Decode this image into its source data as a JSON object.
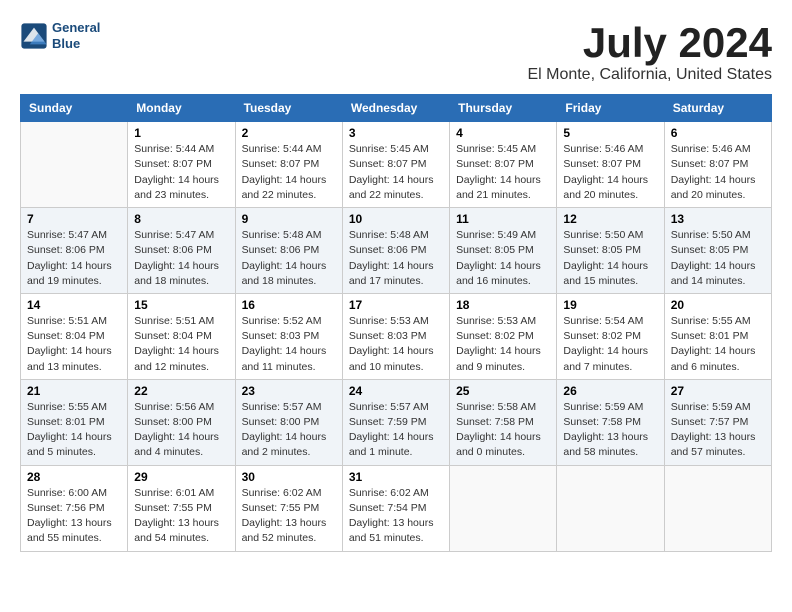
{
  "logo": {
    "line1": "General",
    "line2": "Blue"
  },
  "title": "July 2024",
  "location": "El Monte, California, United States",
  "weekdays": [
    "Sunday",
    "Monday",
    "Tuesday",
    "Wednesday",
    "Thursday",
    "Friday",
    "Saturday"
  ],
  "weeks": [
    [
      {
        "day": "",
        "info": ""
      },
      {
        "day": "1",
        "info": "Sunrise: 5:44 AM\nSunset: 8:07 PM\nDaylight: 14 hours\nand 23 minutes."
      },
      {
        "day": "2",
        "info": "Sunrise: 5:44 AM\nSunset: 8:07 PM\nDaylight: 14 hours\nand 22 minutes."
      },
      {
        "day": "3",
        "info": "Sunrise: 5:45 AM\nSunset: 8:07 PM\nDaylight: 14 hours\nand 22 minutes."
      },
      {
        "day": "4",
        "info": "Sunrise: 5:45 AM\nSunset: 8:07 PM\nDaylight: 14 hours\nand 21 minutes."
      },
      {
        "day": "5",
        "info": "Sunrise: 5:46 AM\nSunset: 8:07 PM\nDaylight: 14 hours\nand 20 minutes."
      },
      {
        "day": "6",
        "info": "Sunrise: 5:46 AM\nSunset: 8:07 PM\nDaylight: 14 hours\nand 20 minutes."
      }
    ],
    [
      {
        "day": "7",
        "info": "Sunrise: 5:47 AM\nSunset: 8:06 PM\nDaylight: 14 hours\nand 19 minutes."
      },
      {
        "day": "8",
        "info": "Sunrise: 5:47 AM\nSunset: 8:06 PM\nDaylight: 14 hours\nand 18 minutes."
      },
      {
        "day": "9",
        "info": "Sunrise: 5:48 AM\nSunset: 8:06 PM\nDaylight: 14 hours\nand 18 minutes."
      },
      {
        "day": "10",
        "info": "Sunrise: 5:48 AM\nSunset: 8:06 PM\nDaylight: 14 hours\nand 17 minutes."
      },
      {
        "day": "11",
        "info": "Sunrise: 5:49 AM\nSunset: 8:05 PM\nDaylight: 14 hours\nand 16 minutes."
      },
      {
        "day": "12",
        "info": "Sunrise: 5:50 AM\nSunset: 8:05 PM\nDaylight: 14 hours\nand 15 minutes."
      },
      {
        "day": "13",
        "info": "Sunrise: 5:50 AM\nSunset: 8:05 PM\nDaylight: 14 hours\nand 14 minutes."
      }
    ],
    [
      {
        "day": "14",
        "info": "Sunrise: 5:51 AM\nSunset: 8:04 PM\nDaylight: 14 hours\nand 13 minutes."
      },
      {
        "day": "15",
        "info": "Sunrise: 5:51 AM\nSunset: 8:04 PM\nDaylight: 14 hours\nand 12 minutes."
      },
      {
        "day": "16",
        "info": "Sunrise: 5:52 AM\nSunset: 8:03 PM\nDaylight: 14 hours\nand 11 minutes."
      },
      {
        "day": "17",
        "info": "Sunrise: 5:53 AM\nSunset: 8:03 PM\nDaylight: 14 hours\nand 10 minutes."
      },
      {
        "day": "18",
        "info": "Sunrise: 5:53 AM\nSunset: 8:02 PM\nDaylight: 14 hours\nand 9 minutes."
      },
      {
        "day": "19",
        "info": "Sunrise: 5:54 AM\nSunset: 8:02 PM\nDaylight: 14 hours\nand 7 minutes."
      },
      {
        "day": "20",
        "info": "Sunrise: 5:55 AM\nSunset: 8:01 PM\nDaylight: 14 hours\nand 6 minutes."
      }
    ],
    [
      {
        "day": "21",
        "info": "Sunrise: 5:55 AM\nSunset: 8:01 PM\nDaylight: 14 hours\nand 5 minutes."
      },
      {
        "day": "22",
        "info": "Sunrise: 5:56 AM\nSunset: 8:00 PM\nDaylight: 14 hours\nand 4 minutes."
      },
      {
        "day": "23",
        "info": "Sunrise: 5:57 AM\nSunset: 8:00 PM\nDaylight: 14 hours\nand 2 minutes."
      },
      {
        "day": "24",
        "info": "Sunrise: 5:57 AM\nSunset: 7:59 PM\nDaylight: 14 hours\nand 1 minute."
      },
      {
        "day": "25",
        "info": "Sunrise: 5:58 AM\nSunset: 7:58 PM\nDaylight: 14 hours\nand 0 minutes."
      },
      {
        "day": "26",
        "info": "Sunrise: 5:59 AM\nSunset: 7:58 PM\nDaylight: 13 hours\nand 58 minutes."
      },
      {
        "day": "27",
        "info": "Sunrise: 5:59 AM\nSunset: 7:57 PM\nDaylight: 13 hours\nand 57 minutes."
      }
    ],
    [
      {
        "day": "28",
        "info": "Sunrise: 6:00 AM\nSunset: 7:56 PM\nDaylight: 13 hours\nand 55 minutes."
      },
      {
        "day": "29",
        "info": "Sunrise: 6:01 AM\nSunset: 7:55 PM\nDaylight: 13 hours\nand 54 minutes."
      },
      {
        "day": "30",
        "info": "Sunrise: 6:02 AM\nSunset: 7:55 PM\nDaylight: 13 hours\nand 52 minutes."
      },
      {
        "day": "31",
        "info": "Sunrise: 6:02 AM\nSunset: 7:54 PM\nDaylight: 13 hours\nand 51 minutes."
      },
      {
        "day": "",
        "info": ""
      },
      {
        "day": "",
        "info": ""
      },
      {
        "day": "",
        "info": ""
      }
    ]
  ]
}
